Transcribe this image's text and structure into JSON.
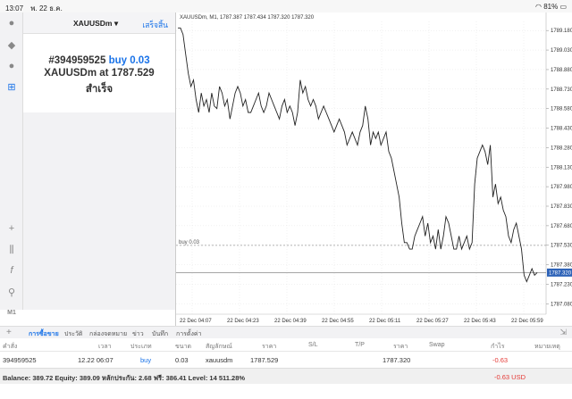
{
  "status": {
    "time": "13:07",
    "date": "พ. 22 ธ.ค.",
    "battery": "81%"
  },
  "trade_panel": {
    "symbol": "XAUUSDm",
    "done_label": "เสร็จสิ้น",
    "order_id": "#394959525",
    "action": "buy 0.03",
    "line2_prefix": "XAUUSDm at",
    "price": "1787.529",
    "result": "สำเร็จ"
  },
  "toolbar": {
    "timeframe": "M1"
  },
  "chart_data": {
    "type": "line",
    "title": "XAUUSDm, M1, 1787.387 1787.434 1787.320 1787.320",
    "x_ticks": [
      "22 Dec 04:07",
      "22 Dec 04:23",
      "22 Dec 04:39",
      "22 Dec 04:55",
      "22 Dec 05:11",
      "22 Dec 05:27",
      "22 Dec 05:43",
      "22 Dec 05:59"
    ],
    "y_ticks": [
      "1789.180",
      "1789.030",
      "1788.880",
      "1788.730",
      "1788.580",
      "1788.430",
      "1788.280",
      "1788.130",
      "1787.980",
      "1787.830",
      "1787.680",
      "1787.530",
      "1787.380",
      "1787.230",
      "1787.080"
    ],
    "ylim": [
      1787.0,
      1789.25
    ],
    "order_line": {
      "label": "buy 0.03",
      "value": 1787.529
    },
    "current_price": "1787.320",
    "current_value": 1787.32,
    "values": [
      1789.2,
      1789.2,
      1789.15,
      1789.0,
      1788.85,
      1788.75,
      1788.8,
      1788.65,
      1788.55,
      1788.7,
      1788.6,
      1788.65,
      1788.55,
      1788.7,
      1788.6,
      1788.58,
      1788.75,
      1788.7,
      1788.6,
      1788.65,
      1788.5,
      1788.6,
      1788.7,
      1788.75,
      1788.7,
      1788.6,
      1788.65,
      1788.55,
      1788.55,
      1788.6,
      1788.65,
      1788.7,
      1788.6,
      1788.55,
      1788.6,
      1788.7,
      1788.65,
      1788.6,
      1788.55,
      1788.5,
      1788.6,
      1788.65,
      1788.55,
      1788.6,
      1788.55,
      1788.45,
      1788.55,
      1788.8,
      1788.7,
      1788.75,
      1788.65,
      1788.6,
      1788.65,
      1788.6,
      1788.5,
      1788.55,
      1788.6,
      1788.55,
      1788.5,
      1788.45,
      1788.4,
      1788.45,
      1788.5,
      1788.45,
      1788.4,
      1788.3,
      1788.35,
      1788.4,
      1788.35,
      1788.3,
      1788.4,
      1788.45,
      1788.6,
      1788.5,
      1788.3,
      1788.4,
      1788.35,
      1788.4,
      1788.3,
      1788.35,
      1788.4,
      1788.25,
      1788.2,
      1788.1,
      1788.0,
      1787.9,
      1787.7,
      1787.55,
      1787.55,
      1787.5,
      1787.5,
      1787.6,
      1787.65,
      1787.7,
      1787.75,
      1787.6,
      1787.7,
      1787.55,
      1787.6,
      1787.5,
      1787.65,
      1787.5,
      1787.6,
      1787.75,
      1787.7,
      1787.6,
      1787.5,
      1787.5,
      1787.6,
      1787.5,
      1787.55,
      1787.6,
      1787.5,
      1787.55,
      1788.0,
      1788.2,
      1788.25,
      1788.3,
      1788.25,
      1788.15,
      1788.3,
      1787.9,
      1788.0,
      1787.85,
      1787.9,
      1787.8,
      1787.75,
      1787.6,
      1787.55,
      1787.65,
      1787.7,
      1787.6,
      1787.5,
      1787.3,
      1787.25,
      1787.3,
      1787.35,
      1787.3,
      1787.32
    ]
  },
  "bottom_tabs": [
    "การซื้อขาย",
    "ประวัติ",
    "กล่องจดหมาย",
    "ข่าว",
    "บันทึก",
    "การตั้งค่า"
  ],
  "table": {
    "headers": [
      "คำสั่ง",
      "เวลา",
      "ประเภท",
      "ขนาด",
      "สัญลักษณ์",
      "ราคา",
      "S/L",
      "T/P",
      "ราคา",
      "Swap",
      "กำไร",
      "หมายเหตุ"
    ],
    "row": {
      "order": "394959525",
      "time": "12.22 06:07",
      "type": "buy",
      "size": "0.03",
      "symbol": "xauusdm",
      "price": "1787.529",
      "current": "1787.320",
      "profit": "-0.63"
    }
  },
  "balance_line": "Balance: 389.72 Equity: 389.09 หลักประกัน: 2.68 ฟรี: 386.41 Level: 14 511.28%",
  "total_profit": "-0.63  USD",
  "colors": {
    "accent": "#1a73e8",
    "loss": "#e53935",
    "price_tag": "#2e63b8"
  }
}
